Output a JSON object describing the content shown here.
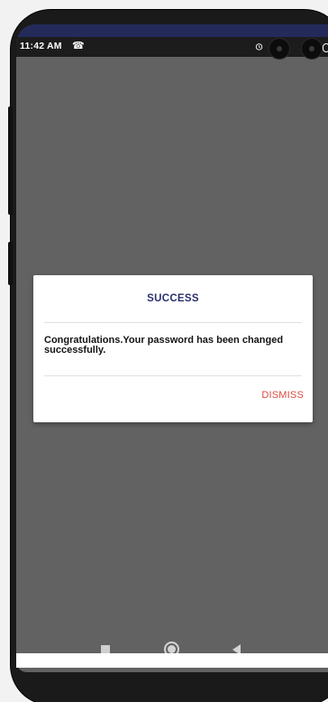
{
  "status_bar": {
    "time": "11:42 AM",
    "call_icon": "missed-call-icon",
    "alarm_icon": "alarm-icon",
    "battery_icon": "battery-icon"
  },
  "dialog": {
    "title": "SUCCESS",
    "message": "Congratulations.Your password has been changed successfully.",
    "dismiss_label": "DISMISS"
  },
  "nav_bar": {
    "recents_icon": "recents-square-icon",
    "home_icon": "home-circle-icon",
    "back_icon": "back-triangle-icon"
  },
  "colors": {
    "status_bar_accent": "#242a5a",
    "title": "#2a2f6e",
    "dismiss": "#d94a3f",
    "scrim": "#626262"
  }
}
